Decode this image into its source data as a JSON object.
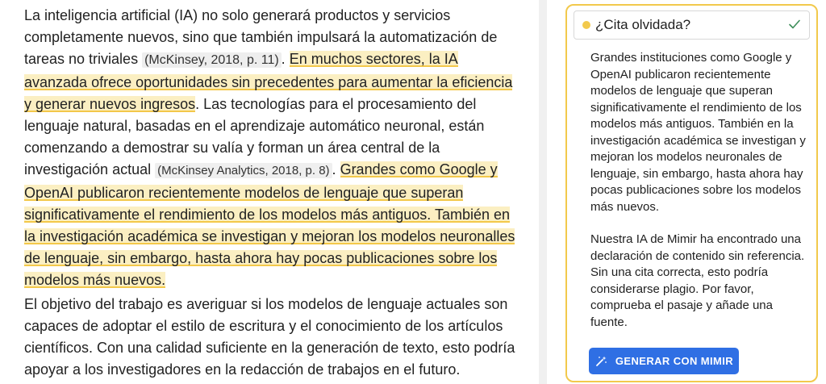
{
  "document": {
    "p1": {
      "t1": "La inteligencia artificial (IA) no solo generará productos y servicios completamente nuevos, sino que también impulsará la automatización de tareas no triviales ",
      "cite1": "(McKinsey, 2018, p. 11)",
      "t2": ". ",
      "hl1": "En muchos sectores, la IA avanzada ofrece oportunidades sin precedentes para aumentar la eficiencia y generar nuevos ingresos",
      "t3": ". Las tecnologías para el procesamiento del lenguaje natural, basadas en el aprendizaje automático neuronal, están comenzando a demostrar su valía y forman un área central de la investigación actual ",
      "cite2": "(McKinsey Analytics, 2018, p. 8)",
      "t4": ". ",
      "hl2": "Grandes como Google y OpenAI publicaron recientemente modelos de lenguaje que superan significativamente el rendimiento de los modelos más antiguos. También en la investigación académica se investigan y mejoran los modelos neuronalles de lenguaje, sin embargo, hasta ahora hay pocas publicaciones sobre los modelos más nuevos."
    },
    "p2": "El objetivo del trabajo es averiguar si los modelos de lenguaje actuales son capaces de adoptar el estilo de escritura y el conocimiento de los artículos científicos. Con una calidad suficiente en la generación de texto, esto podría apoyar a los investigadores en la redacción de trabajos en el futuro."
  },
  "panel": {
    "title": "¿Cita olvidada?",
    "accent_color": "#f2c94c",
    "check_icon": "check-icon",
    "quote": "Grandes instituciones como Google y OpenAI publicaron recientemente modelos de lenguaje que superan significativamente el rendimiento de los modelos más antiguos. También en la investigación académica se investigan y mejoran los modelos neuronales de lenguaje, sin embargo, hasta ahora hay pocas publicaciones sobre los modelos más nuevos.",
    "message": "Nuestra IA de Mimir ha encontrado una declaración de contenido sin referencia. Sin una cita correcta, esto podría considerarse plagio. Por favor, comprueba el pasaje y añade una fuente.",
    "button_label": "GENERAR CON MIMIR",
    "button_icon": "magic-wand-icon",
    "button_color": "#2f6fe4"
  }
}
